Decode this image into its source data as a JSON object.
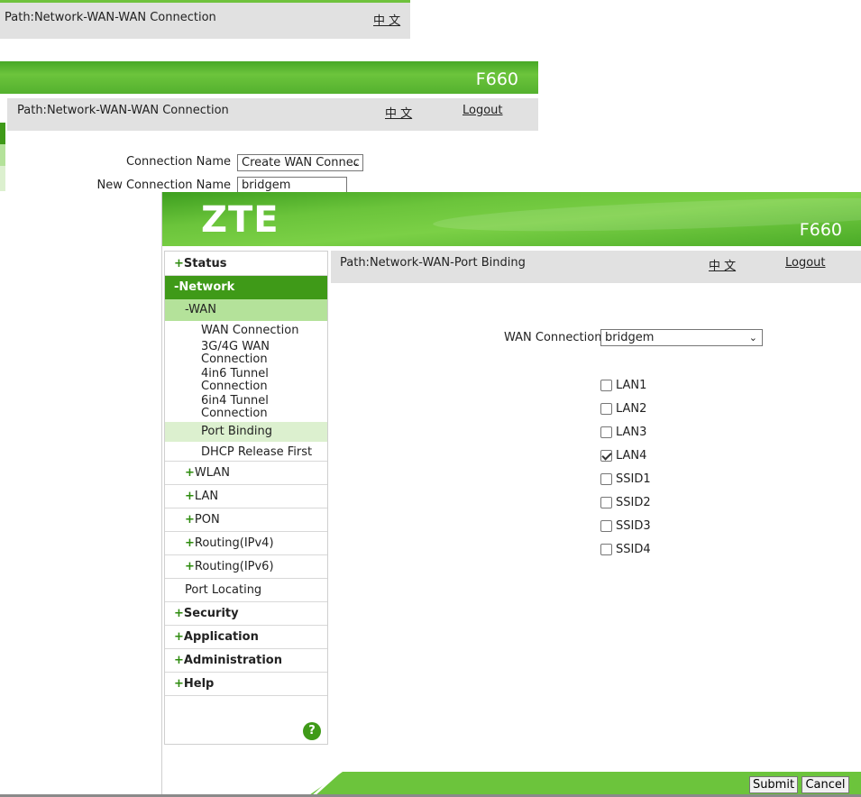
{
  "bg_window_1": {
    "path": "Path:Network-WAN-WAN Connection",
    "lang": "中 文"
  },
  "bg_window_2": {
    "model": "F660",
    "path": "Path:Network-WAN-WAN Connection",
    "lang": "中 文",
    "logout": "Logout",
    "connection_name_label": "Connection Name",
    "connection_name_value": "Create WAN Connec",
    "new_connection_name_label": "New Connection Name",
    "new_connection_name_value": "bridgem"
  },
  "header": {
    "logo": "ZTE",
    "model": "F660"
  },
  "topbar": {
    "path": "Path:Network-WAN-Port Binding",
    "lang": "中 文",
    "logout": "Logout"
  },
  "sidebar": {
    "status": "Status",
    "network": "-Network",
    "wan": "-WAN",
    "wan_connection": "WAN Connection",
    "g34_wan_1": "3G/4G WAN",
    "g34_wan_2": "Connection",
    "tunnel_4in6_1": "4in6 Tunnel",
    "tunnel_4in6_2": "Connection",
    "tunnel_6in4_1": "6in4 Tunnel",
    "tunnel_6in4_2": "Connection",
    "port_binding": "Port Binding",
    "dhcp_release_first": "DHCP Release First",
    "wlan": "WLAN",
    "lan": "LAN",
    "pon": "PON",
    "routing_ipv4": "Routing(IPv4)",
    "routing_ipv6": "Routing(IPv6)",
    "port_locating": "Port Locating",
    "security": "Security",
    "application": "Application",
    "administration": "Administration",
    "help": "Help",
    "plus": "+",
    "help_icon": "?"
  },
  "form": {
    "wan_connection_label": "WAN Connection",
    "wan_connection_value": "bridgem",
    "ports": [
      {
        "label": "LAN1",
        "checked": false
      },
      {
        "label": "LAN2",
        "checked": false
      },
      {
        "label": "LAN3",
        "checked": false
      },
      {
        "label": "LAN4",
        "checked": true
      },
      {
        "label": "SSID1",
        "checked": false
      },
      {
        "label": "SSID2",
        "checked": false
      },
      {
        "label": "SSID3",
        "checked": false
      },
      {
        "label": "SSID4",
        "checked": false
      }
    ]
  },
  "footer": {
    "submit": "Submit",
    "cancel": "Cancel"
  },
  "colors": {
    "brand_green": "#3f9a18",
    "light_green": "#b4e29a",
    "pale_green": "#dcf0cf",
    "bar_grey": "#e1e1e1"
  }
}
